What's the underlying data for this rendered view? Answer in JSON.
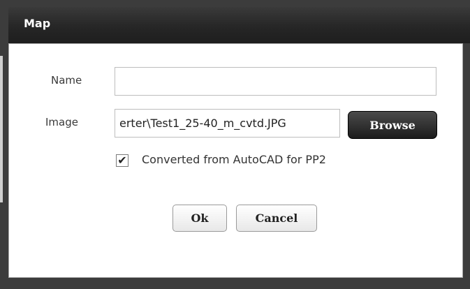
{
  "dialog": {
    "title": "Map",
    "name_label": "Name",
    "name_value": "",
    "image_label": "Image",
    "image_value": "erter\\Test1_25-40_m_cvtd.JPG",
    "browse_label": "Browse",
    "checkbox_checked": true,
    "checkbox_label": "Converted from AutoCAD for PP2",
    "ok_label": "Ok",
    "cancel_label": "Cancel"
  },
  "colors": {
    "titlebar": "#262626",
    "frame": "#3c3c3c",
    "panel": "#ffffff"
  },
  "icons": {
    "checkbox_mark": "check-icon"
  }
}
